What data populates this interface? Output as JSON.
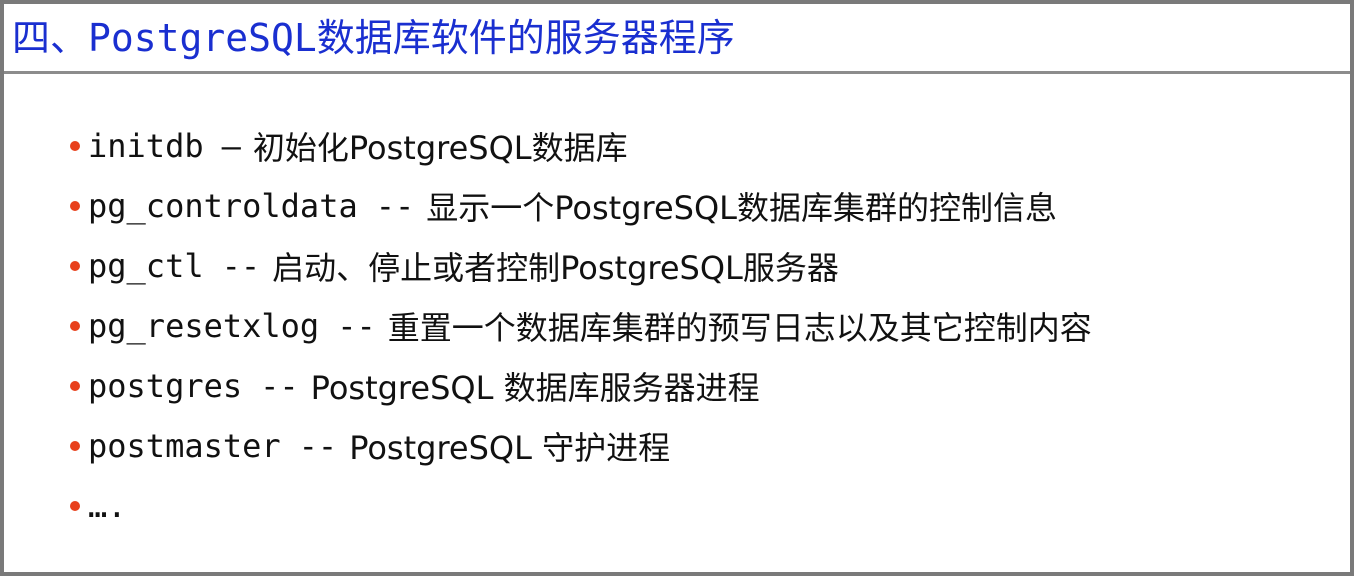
{
  "slide": {
    "title": "四、PostgreSQL数据库软件的服务器程序",
    "bullet_color": "#e8401c",
    "title_color": "#1a2fd0",
    "items": [
      {
        "cmd": "initdb",
        "sep": "–",
        "desc": "初始化PostgreSQL数据库"
      },
      {
        "cmd": "pg_controldata",
        "sep": "--",
        "desc": "显示一个PostgreSQL数据库集群的控制信息"
      },
      {
        "cmd": "pg_ctl",
        "sep": "--",
        "desc": "启动、停止或者控制PostgreSQL服务器"
      },
      {
        "cmd": "pg_resetxlog",
        "sep": "--",
        "desc": "重置一个数据库集群的预写日志以及其它控制内容"
      },
      {
        "cmd": "postgres",
        "sep": "--",
        "desc": "PostgreSQL 数据库服务器进程"
      },
      {
        "cmd": "postmaster",
        "sep": "--",
        "desc": "PostgreSQL 守护进程"
      },
      {
        "cmd": "….",
        "sep": "",
        "desc": ""
      }
    ]
  }
}
